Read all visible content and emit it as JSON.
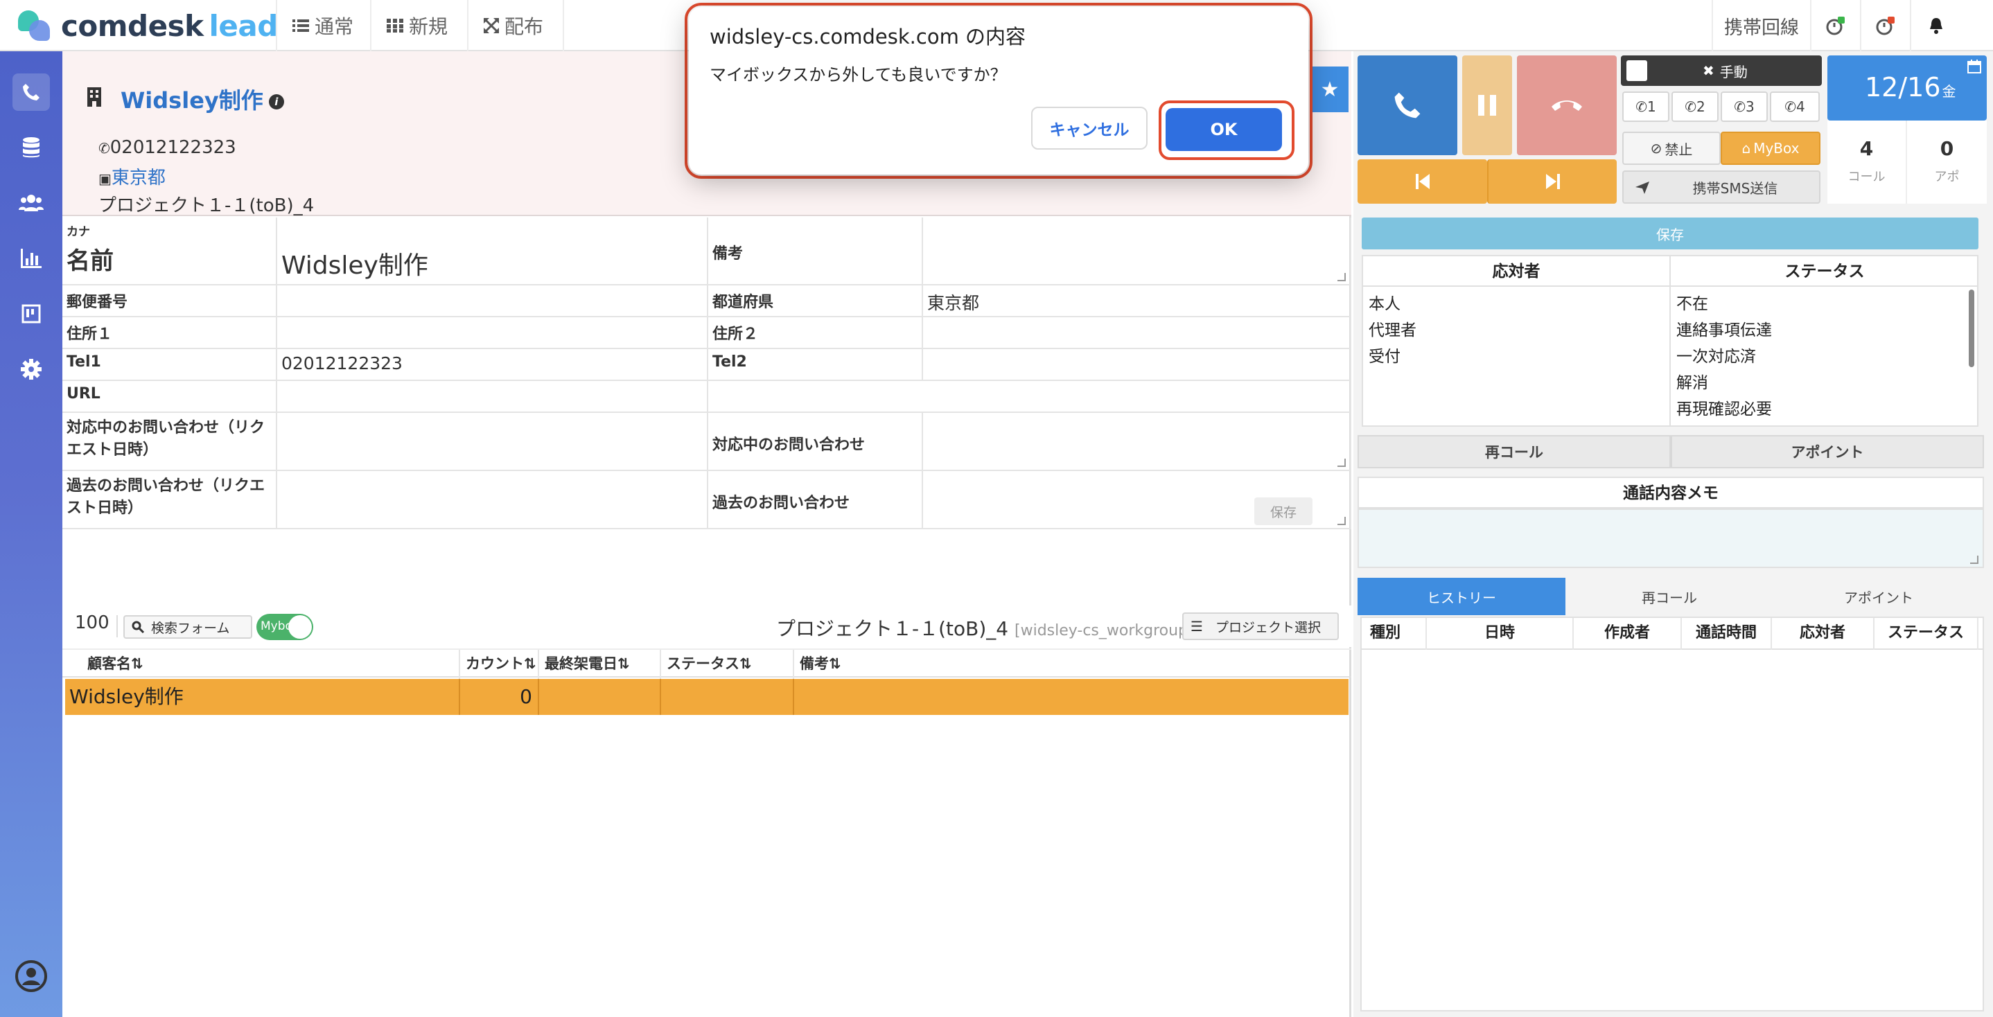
{
  "brand": {
    "word1": "comdesk",
    "word2": "lead"
  },
  "topnav": [
    {
      "label": "通常",
      "icon": "list-icon"
    },
    {
      "label": "新規",
      "icon": "grid-icon"
    },
    {
      "label": "配布",
      "icon": "expand-arrows-icon"
    }
  ],
  "topright": {
    "mobile_line": "携帯回線"
  },
  "company": {
    "name": "Widsley制作",
    "phone": "02012122323",
    "prefecture": "東京都",
    "project": "プロジェクト１-１(toB)_4"
  },
  "detail": {
    "kana_label": "カナ",
    "name_label": "名前",
    "name_value": "Widsley制作",
    "memo_label": "備考",
    "postal_label": "郵便番号",
    "pref_label": "都道府県",
    "pref_value": "東京都",
    "addr1_label": "住所１",
    "addr2_label": "住所２",
    "tel1_label": "Tel1",
    "tel1_value": "02012122323",
    "tel2_label": "Tel2",
    "url_label": "URL",
    "cur_inq_date_label": "対応中のお問い合わせ（リクエスト日時）",
    "cur_inq_label": "対応中のお問い合わせ",
    "past_inq_date_label": "過去のお問い合わせ（リクエスト日時）",
    "past_inq_label": "過去のお問い合わせ",
    "save_label": "保存"
  },
  "list": {
    "count": "100",
    "search_label": "検索フォーム",
    "toggle_label": "Mybox",
    "project_title": "プロジェクト１-１(toB)_4",
    "workgroup": "[widsley-cs_workgroup]",
    "select_label": "プロジェクト選択",
    "columns": [
      "顧客名⇅",
      "カウント⇅",
      "最終架電日⇅",
      "ステータス⇅",
      "備考⇅"
    ],
    "rows": [
      {
        "name": "Widsley制作",
        "count": "0",
        "last": "",
        "status": "",
        "memo": ""
      }
    ]
  },
  "phone": {
    "manual_label": "手動",
    "lines": [
      "1",
      "2",
      "3",
      "4"
    ],
    "ban_label": "禁止",
    "mybox_label": "MyBox",
    "sms_label": "携帯SMS送信",
    "date": "12/16",
    "weekday": "金",
    "call_count": "4",
    "call_label": "コール",
    "appo_count": "0",
    "appo_label": "アポ"
  },
  "status_panel": {
    "save_label": "保存",
    "responder_header": "応対者",
    "status_header": "ステータス",
    "responders": [
      "本人",
      "代理者",
      "受付"
    ],
    "statuses": [
      "不在",
      "連絡事項伝達",
      "一次対応済",
      "解消",
      "再現確認必要"
    ],
    "recall_label": "再コール",
    "appoint_label": "アポイント",
    "memo_header": "通話内容メモ"
  },
  "history": {
    "tabs": [
      "ヒストリー",
      "再コール",
      "アポイント"
    ],
    "columns": [
      "種別",
      "日時",
      "作成者",
      "通話時間",
      "応対者",
      "ステータス"
    ]
  },
  "dialog": {
    "title": "widsley-cs.comdesk.com の内容",
    "message": "マイボックスから外しても良いですか？",
    "cancel": "キャンセル",
    "ok": "OK"
  },
  "colors": {
    "sidebar": "#5566cc",
    "accent_blue": "#2f6fe0",
    "row_highlight": "#f2a93b",
    "call_blue": "#3a7fc9",
    "hangup_red": "#e49a94",
    "nav_orange": "#f0ad45",
    "alert_ring": "#e24b2e"
  }
}
